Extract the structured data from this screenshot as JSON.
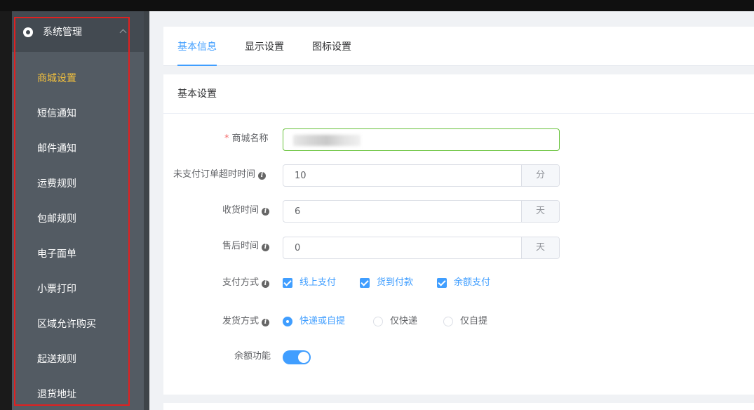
{
  "sidebar": {
    "title": "系统管理",
    "items": [
      {
        "label": "商城设置",
        "active": true
      },
      {
        "label": "短信通知"
      },
      {
        "label": "邮件通知"
      },
      {
        "label": "运费规则"
      },
      {
        "label": "包邮规则"
      },
      {
        "label": "电子面单"
      },
      {
        "label": "小票打印"
      },
      {
        "label": "区域允许购买"
      },
      {
        "label": "起送规则"
      },
      {
        "label": "退货地址"
      }
    ]
  },
  "tabs": [
    "基本信息",
    "显示设置",
    "图标设置"
  ],
  "card": {
    "title": "基本设置"
  },
  "form": {
    "shop_name": {
      "label": "商城名称",
      "required_mark": "*"
    },
    "unpaid_timeout": {
      "label": "未支付订单超时时间",
      "value": "10",
      "unit": "分"
    },
    "receive_time": {
      "label": "收货时间",
      "value": "6",
      "unit": "天"
    },
    "after_sale_time": {
      "label": "售后时间",
      "value": "0",
      "unit": "天"
    },
    "payment": {
      "label": "支付方式",
      "options": [
        {
          "label": "线上支付",
          "checked": true
        },
        {
          "label": "货到付款",
          "checked": true
        },
        {
          "label": "余额支付",
          "checked": true
        }
      ]
    },
    "delivery": {
      "label": "发货方式",
      "options": [
        {
          "label": "快递或自提",
          "selected": true
        },
        {
          "label": "仅快递",
          "selected": false
        },
        {
          "label": "仅自提",
          "selected": false
        }
      ]
    },
    "balance": {
      "label": "余额功能",
      "enabled": true
    }
  },
  "colors": {
    "accent": "#409eff",
    "active_menu": "#f2c03e",
    "highlight_box": "#e02020"
  },
  "icons": {
    "sidebar_head": "settings-icon",
    "info": "info-icon"
  }
}
